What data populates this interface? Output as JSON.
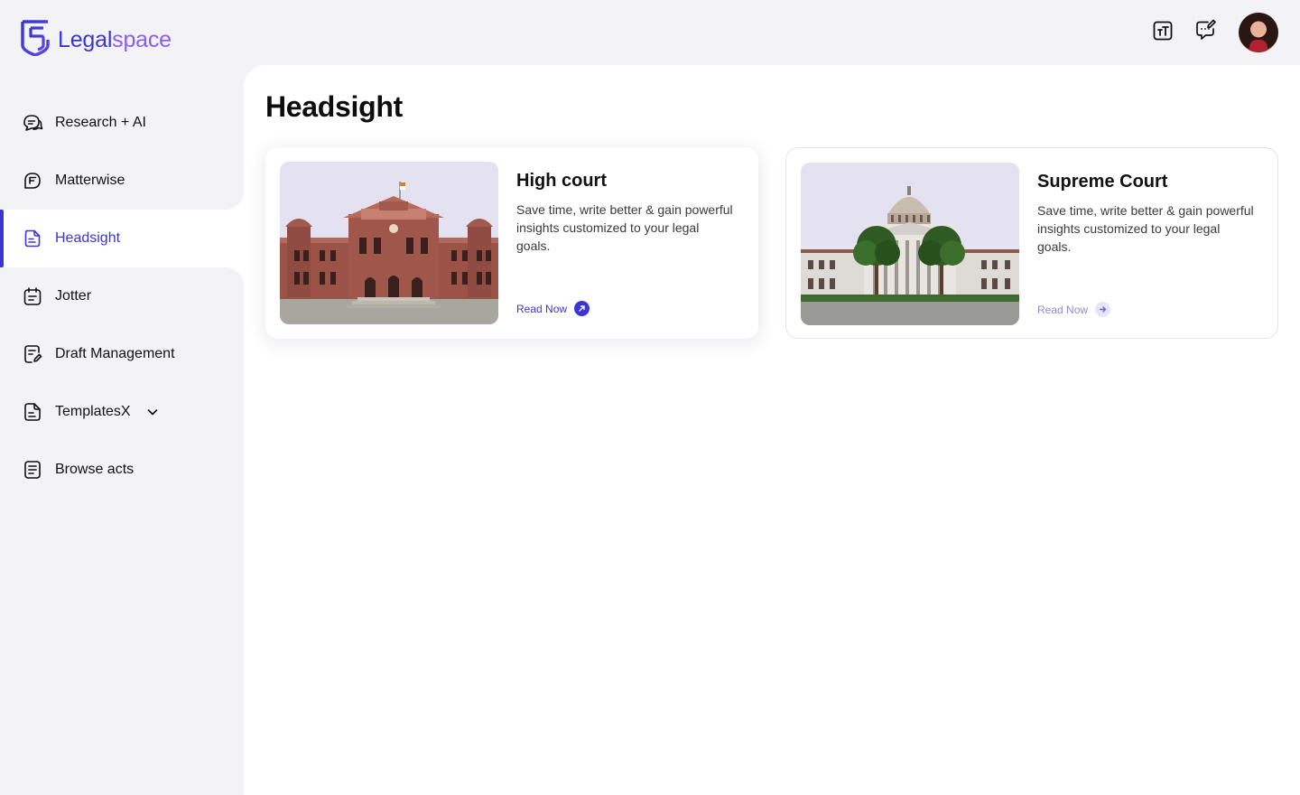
{
  "brand": {
    "name_part1": "Legal",
    "name_part2": "space",
    "color_primary": "#3a35d4",
    "color_secondary": "#8b5cf0"
  },
  "header": {
    "actions": [
      {
        "icon": "text-size-icon"
      },
      {
        "icon": "chat-edit-icon"
      }
    ],
    "avatar": {
      "icon": "user-avatar"
    }
  },
  "sidebar": {
    "items": [
      {
        "label": "Research + AI",
        "icon": "chat-bubbles-icon",
        "active": false
      },
      {
        "label": "Matterwise",
        "icon": "matterwise-icon",
        "active": false
      },
      {
        "label": "Headsight",
        "icon": "document-icon",
        "active": true
      },
      {
        "label": "Jotter",
        "icon": "notepad-icon",
        "active": false
      },
      {
        "label": "Draft Management",
        "icon": "draft-edit-icon",
        "active": false
      },
      {
        "label": "TemplatesX",
        "icon": "template-icon",
        "active": false,
        "has_dropdown": true
      },
      {
        "label": "Browse acts",
        "icon": "book-icon",
        "active": false
      }
    ]
  },
  "main": {
    "title": "Headsight",
    "cards": [
      {
        "title": "High court",
        "description": "Save time, write better & gain powerful insights customized to your legal goals.",
        "cta": "Read Now",
        "image": "high-court-building"
      },
      {
        "title": "Supreme Court",
        "description": "Save time, write better & gain powerful insights customized to your legal goals.",
        "cta": "Read Now",
        "image": "supreme-court-building"
      }
    ]
  }
}
